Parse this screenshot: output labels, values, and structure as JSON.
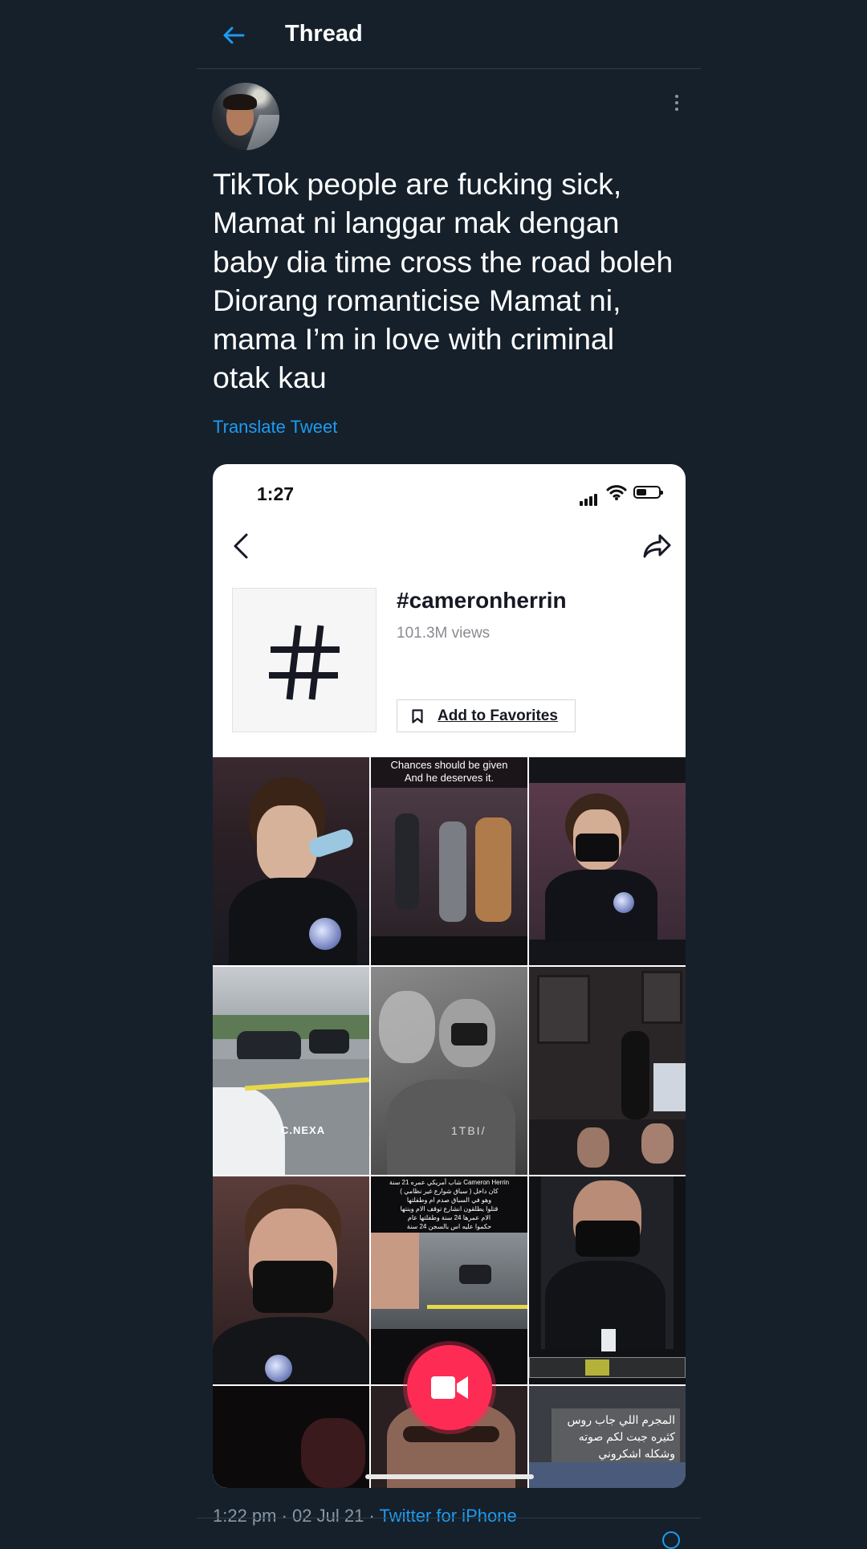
{
  "header": {
    "title": "Thread"
  },
  "tweet": {
    "text": "TikTok people are fucking sick,\nMamat ni langgar mak dengan\nbaby dia time cross the road boleh\nDiorang romanticise Mamat ni,\nmama I’m in love with criminal\notak kau",
    "translate_label": "Translate Tweet"
  },
  "embedded_screenshot": {
    "status_time": "1:27",
    "hashtag": "#cameronherrin",
    "views": "101.3M views",
    "favorite_label": "Add to Favorites",
    "tiles": [
      {
        "caption": "Chances should be given\nAnd he deserves it."
      },
      {
        "watermark": "C.NEXA"
      },
      {
        "watermark": "1TBI/"
      },
      {
        "caption": "شاب أمريكي عمره 21 سنة Cameron Herrin\nكان داخل ( سباق شوارع غير نظامي )\nوهو في السباق صدم ام وطفلتها\nقتلوا يطلقون انشارع توقف الام وبنتها\nالام عمرها 24 سنة وطفلتها عام\nحكموا عليه اس بالسجن 24 سنة"
      },
      {
        "caption": "المجرم اللي جاب روس\nكثيره جبت لكم صوته\nوشكله اشكروني"
      }
    ]
  },
  "meta": {
    "time_date": "1:22 pm · 02 Jul 21 · ",
    "source": "Twitter for iPhone"
  },
  "colors": {
    "background": "#15202b",
    "accent": "#1d9bf0",
    "tiktok_red": "#fe2c55"
  },
  "icons": [
    "back-arrow-icon",
    "more-vertical-icon",
    "signal-icon",
    "wifi-icon",
    "battery-icon",
    "chevron-left-icon",
    "share-icon",
    "hashtag-icon",
    "bookmark-icon",
    "video-camera-icon"
  ]
}
